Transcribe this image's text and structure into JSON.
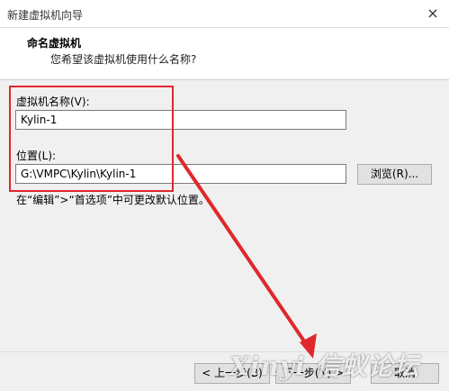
{
  "window": {
    "title": "新建虚拟机向导",
    "close_icon": "×"
  },
  "header": {
    "title": "命名虚拟机",
    "subtitle": "您希望该虚拟机使用什么名称?"
  },
  "form": {
    "vm_name_label": "虚拟机名称(V):",
    "vm_name_value": "Kylin-1",
    "location_label": "位置(L):",
    "location_value": "G:\\VMPC\\Kylin\\Kylin-1",
    "browse_label": "浏览(R)...",
    "hint": "在“编辑”>“首选项”中可更改默认位置。"
  },
  "footer": {
    "back_label": "< 上一步(B)",
    "next_label": "下一步(N) >",
    "cancel_label": "取消"
  },
  "watermark": "Xinyi 信蚁论坛",
  "colors": {
    "annotation": "#e0282c"
  }
}
